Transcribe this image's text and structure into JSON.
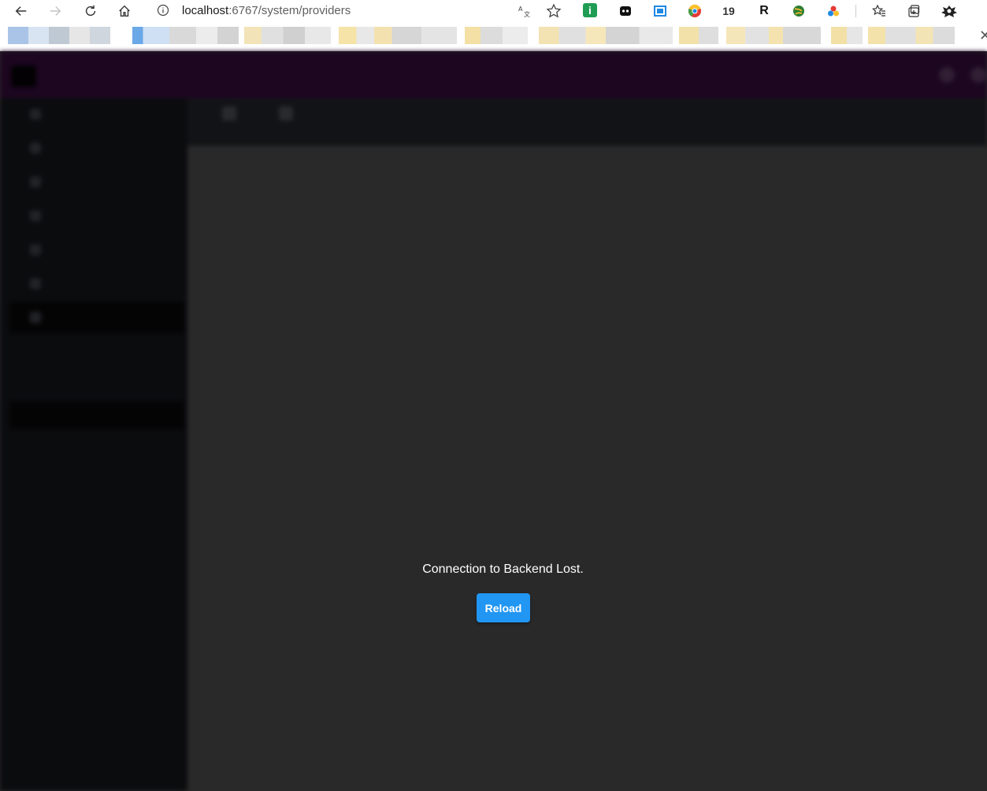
{
  "browser": {
    "url_host": "localhost",
    "url_rest": ":6767/system/providers",
    "extensions": [
      {
        "name": "info-extension-icon",
        "text": "i",
        "color": "#1f9d55"
      },
      {
        "name": "bookmark-extension-icon",
        "text": "",
        "color": "#111111"
      },
      {
        "name": "reader-extension-icon",
        "text": "",
        "color": "#1e88e5"
      },
      {
        "name": "chrome-extension-icon",
        "text": "",
        "color": "#e53935"
      },
      {
        "name": "counter-extension-icon",
        "text": "19",
        "color": "#333333"
      },
      {
        "name": "r-extension-icon",
        "text": "R",
        "color": "#111111"
      },
      {
        "name": "globe-extension-icon",
        "text": "",
        "color": "#2e7d32"
      },
      {
        "name": "colors-extension-icon",
        "text": "",
        "color": "#e53935"
      }
    ]
  },
  "dialog": {
    "message": "Connection to Backend Lost.",
    "reload_label": "Reload"
  },
  "colors": {
    "header": "#230828",
    "sidebar": "#0e0f12",
    "main": "#333333",
    "reload_button": "#2196f3"
  }
}
